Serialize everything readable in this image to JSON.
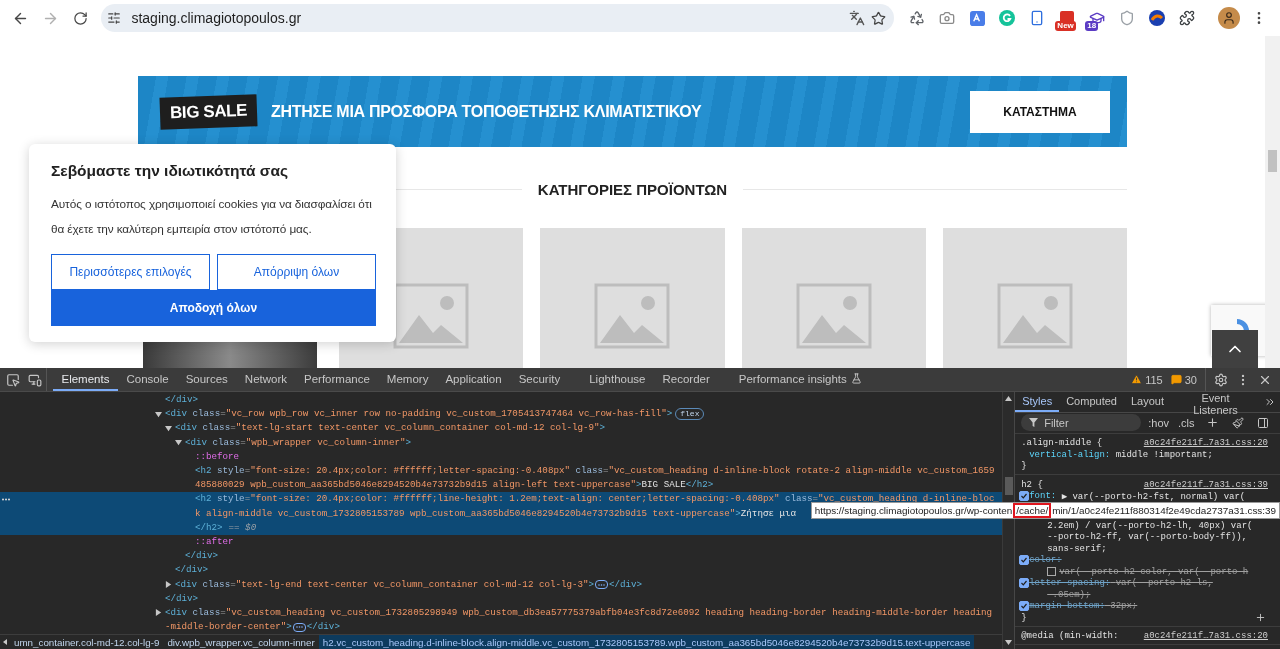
{
  "browser": {
    "url": "staging.climagiotopoulos.gr",
    "extensions": [
      {
        "kind": "recycle"
      },
      {
        "kind": "camera"
      },
      {
        "kind": "translate"
      },
      {
        "kind": "ring"
      },
      {
        "kind": "phone"
      },
      {
        "kind": "news",
        "badge": "New"
      },
      {
        "kind": "cap",
        "badge": "18"
      },
      {
        "kind": "shield"
      },
      {
        "kind": "swirl"
      },
      {
        "kind": "puzzle"
      }
    ]
  },
  "page": {
    "banner": {
      "tag": "BIG SALE",
      "headline": "ΖΗΤΗΣΕ ΜΙΑ ΠΡΟΣΦΟΡΑ ΤΟΠΟΘΕΤΗΣΗΣ ΚΛΙΜΑΤΙΣΤΙΚΟΥ",
      "button": "ΚΑΤΑΣΤΗΜΑ"
    },
    "section_heading": "ΚΑΤΗΓΟΡΙΕΣ ΠΡΟΪΟΝΤΩΝ",
    "products": [
      {
        "kind": "photo"
      },
      {
        "kind": "placeholder"
      },
      {
        "kind": "placeholder"
      },
      {
        "kind": "placeholder"
      },
      {
        "kind": "placeholder"
      }
    ],
    "cookie_notice": {
      "title": "Σεβόμαστε την ιδιωτικότητά σας",
      "text": "Αυτός ο ιστότοπος χρησιμοποιεί cookies για να διασφαλίσει ότι θα έχετε την καλύτερη εμπειρία στον ιστότοπό μας.",
      "buttons": [
        {
          "label": "Περισσότερες επιλογές",
          "kind": "outline"
        },
        {
          "label": "Απόρριψη όλων",
          "kind": "outline"
        },
        {
          "label": "Αποδοχή όλων",
          "kind": "primary"
        }
      ]
    }
  },
  "devtools": {
    "tabs": [
      {
        "label": "Elements",
        "selected": true,
        "kind": "panel"
      },
      {
        "label": "Console",
        "selected": false,
        "kind": "panel"
      },
      {
        "label": "Sources",
        "selected": false,
        "kind": "panel"
      },
      {
        "label": "Network",
        "selected": false,
        "kind": "panel"
      },
      {
        "label": "Performance",
        "selected": false,
        "kind": "panel"
      },
      {
        "label": "Memory",
        "selected": false,
        "kind": "panel"
      },
      {
        "label": "Application",
        "selected": false,
        "kind": "panel"
      },
      {
        "label": "Security",
        "selected": false,
        "kind": "panel"
      },
      {
        "label": "Lighthouse",
        "selected": false,
        "kind": "panel"
      },
      {
        "label": "Recorder",
        "selected": false,
        "kind": "panel"
      },
      {
        "label": "Performance insights",
        "selected": false,
        "kind": "experimental"
      }
    ],
    "warnings": "115",
    "issues": "30",
    "dom_tree": [
      {
        "kind": "element",
        "selected": false,
        "lines": [
          "</div>"
        ]
      },
      {
        "kind": "element",
        "selected": false,
        "expanded": true,
        "lines": [
          "<div class=\"vc_row wpb_row vc_inner row no-padding vc_custom_1705413747464 vc_row-has-fill\">"
        ],
        "badge": "flex",
        "close": "</div>",
        "children": [
          {
            "kind": "element",
            "selected": false,
            "expanded": true,
            "lines": [
              "<div class=\"text-lg-start text-center vc_column_container col-md-12 col-lg-9\">"
            ],
            "close": "</div>",
            "children": [
              {
                "kind": "element",
                "selected": false,
                "expanded": true,
                "lines": [
                  "<div class=\"wpb_wrapper vc_column-inner\">"
                ],
                "close": "</div>",
                "children": [
                  {
                    "kind": "pseudo",
                    "selected": false,
                    "lines": [
                      "::before"
                    ]
                  },
                  {
                    "kind": "element",
                    "selected": false,
                    "lines": [
                      "<h2 style=\"font-size: 20.4px;color: #ffffff;letter-spacing:-0.408px\" class=\"vc_custom_heading d-inline-block rotate-2 align-middle vc_custom_1659",
                      "485880029 wpb_custom_aa365bd5046e8294520b4e73732b9d15 align-left text-uppercase\">BIG SALE</h2>"
                    ]
                  },
                  {
                    "kind": "element",
                    "selected": true,
                    "lines": [
                      "<h2 style=\"font-size: 20.4px;color: #ffffff;line-height: 1.2em;text-align: center;letter-spacing:-0.408px\" class=\"vc_custom_heading d-inline-bloc",
                      "k align-middle vc_custom_1732805153789 wpb_custom_aa365bd5046e8294520b4e73732b9d15 text-uppercase\">Ζήτησε μια",
                      "</h2>"
                    ],
                    "marker": "== $0"
                  },
                  {
                    "kind": "pseudo",
                    "selected": false,
                    "lines": [
                      "::after"
                    ]
                  }
                ]
              }
            ]
          },
          {
            "kind": "element",
            "selected": false,
            "expanded": false,
            "lines": [
              "<div class=\"text-lg-end text-center vc_column_container col-md-12 col-lg-3\">"
            ],
            "close": "</div>"
          }
        ]
      },
      {
        "kind": "element",
        "selected": false,
        "expanded": false,
        "lines": [
          "<div class=\"vc_custom_heading vc_custom_1732805298949 wpb_custom_db3ea57775379abfb04e3fc8d72e6092 heading heading-border heading-middle-border heading",
          "-middle-border-center\">"
        ],
        "close": "</div>"
      }
    ],
    "tooltip": {
      "before": "https://staging.climagiotopoulos.gr/wp-conten",
      "highlight": "/cache/",
      "after": "min/1/a0c24fe211f880314f2e49cda2737a31.css:39"
    },
    "breadcrumbs": [
      {
        "label": "umn_container.col-md-12.col-lg-9",
        "selected": false
      },
      {
        "label": "div.wpb_wrapper.vc_column-inner",
        "selected": false
      },
      {
        "label": "h2.vc_custom_heading.d-inline-block.align-middle.vc_custom_1732805153789.wpb_custom_aa365bd5046e8294520b4e73732b9d15.text-uppercase",
        "selected": true
      }
    ],
    "styles": {
      "tabs": [
        {
          "label": "Styles",
          "selected": true
        },
        {
          "label": "Computed",
          "selected": false
        },
        {
          "label": "Layout",
          "selected": false
        },
        {
          "label": "Event Listeners",
          "selected": false
        }
      ],
      "filter_placeholder": "Filter",
      "toggles": [
        ":hov",
        ".cls"
      ],
      "rules": [
        {
          "selector": ".align-middle {",
          "source": "a0c24fe211f…7a31.css:20",
          "hovered": false,
          "close": "}",
          "declarations": [
            {
              "property": "vertical-align:",
              "value": "middle !important;"
            }
          ]
        },
        {
          "selector": "h2 {",
          "source": "a0c24fe211f…7a31.css:39",
          "hovered": true,
          "close": "}",
          "declarations": [
            {
              "property": "font:",
              "value": "▶ var(--porto-h2-fst, normal) var(",
              "checked": true,
              "overridden": false,
              "continuation": [
                "2.2em) / var(--porto-h2-lh, 40px) var(",
                "--porto-h2-ff, var(--porto-body-ff)),",
                "sans-serif;"
              ]
            },
            {
              "property": "color:",
              "checked": true,
              "overridden": true,
              "swatch": true,
              "continuation": [
                "var(--porto-h2-color, var(--porto-h"
              ]
            },
            {
              "property": "letter-spacing:",
              "value": "var(--porto-h2-ls,",
              "checked": true,
              "overridden": true,
              "continuation": [
                "-.05em);"
              ]
            },
            {
              "property": "margin-bottom:",
              "value": "32px;",
              "checked": true,
              "overridden": true
            }
          ]
        },
        {
          "selector": "@media (min-width:",
          "source": "a0c24fe211f…7a31.css:20"
        }
      ]
    }
  }
}
